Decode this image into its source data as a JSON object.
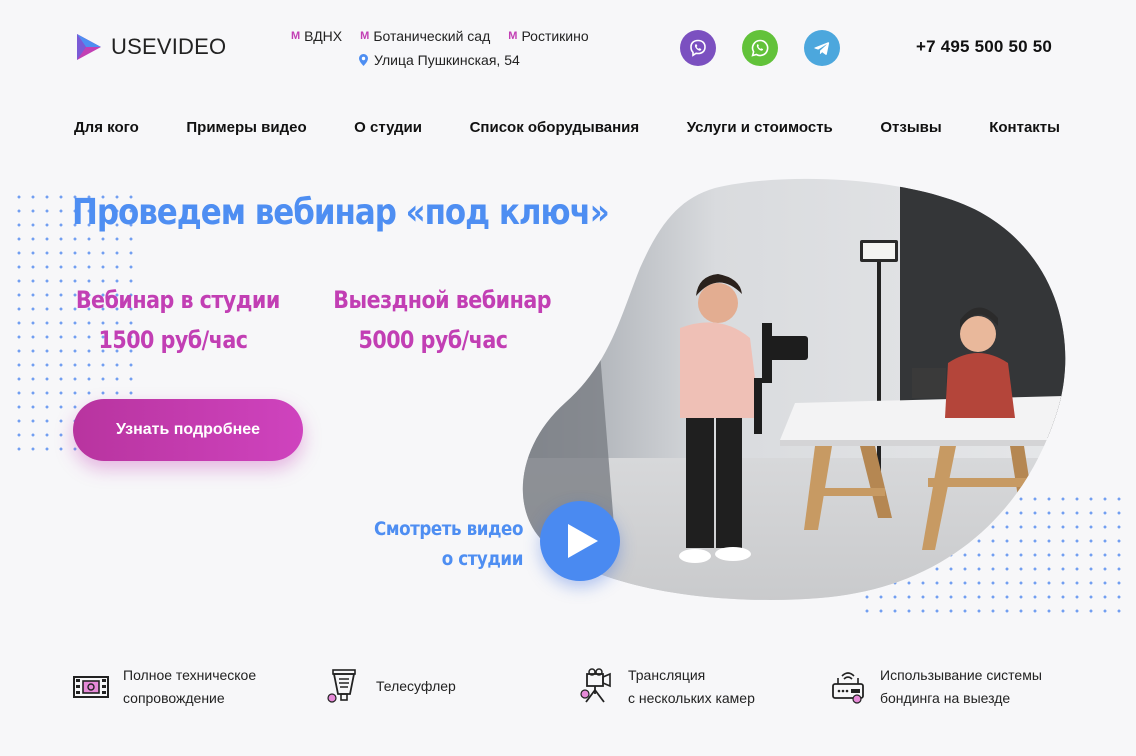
{
  "header": {
    "logo_text": "USEVIDEO",
    "metro": [
      {
        "label": "ВДНХ",
        "icon": "metro-icon"
      },
      {
        "label": "Ботанический сад",
        "icon": "metro-icon"
      },
      {
        "label": "Ростикино",
        "icon": "metro-icon"
      }
    ],
    "address": "Улица Пушкинская, 54",
    "messengers": [
      "viber-icon",
      "whatsapp-icon",
      "telegram-icon"
    ],
    "phone": "+7 495 500 50 50"
  },
  "nav": {
    "items": [
      "Для кого",
      "Примеры видео",
      "О студии",
      "Список оборудывания",
      "Услуги и стоимость",
      "Отзывы",
      "Контакты"
    ]
  },
  "hero": {
    "title": "Проведем вебинар «под ключ»",
    "offers": [
      {
        "name": "Вебинар в студии",
        "price": "1500 руб/час"
      },
      {
        "name": "Выездной вебинар",
        "price": "5000 руб/час"
      }
    ],
    "cta_label": "Узнать подробнее",
    "watch_line1": "Смотреть видео",
    "watch_line2": "о студии"
  },
  "features": [
    {
      "icon": "film-strip-icon",
      "line1": "Полное техническое",
      "line2": "сопровождение"
    },
    {
      "icon": "teleprompter-icon",
      "line1": "Телесуфлер",
      "line2": ""
    },
    {
      "icon": "camera-tripod-icon",
      "line1": "Трансляция",
      "line2": "с нескольких камер"
    },
    {
      "icon": "router-icon",
      "line1": "Использывание системы",
      "line2": "бондинга на выезде"
    }
  ],
  "colors": {
    "accent_blue": "#4e8ef2",
    "accent_magenta": "#c23fb4",
    "background": "#f7f7f9"
  }
}
